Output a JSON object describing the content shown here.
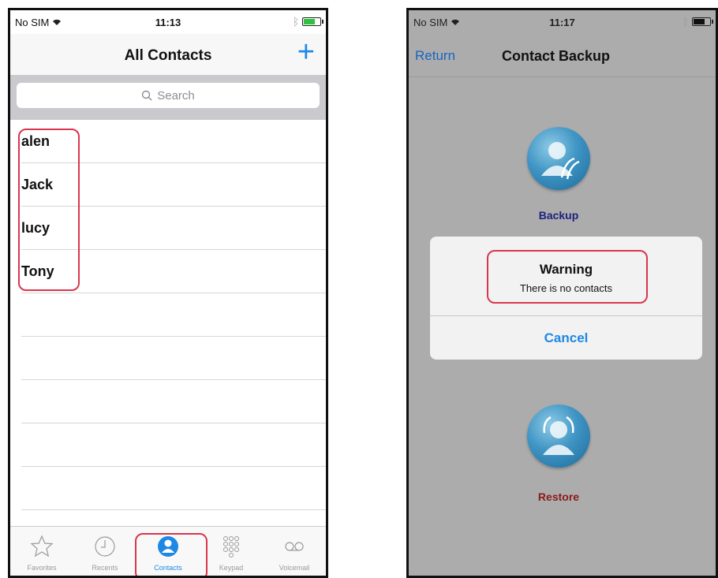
{
  "left_screen": {
    "status": {
      "carrier": "No SIM",
      "time": "11:13"
    },
    "nav": {
      "title": "All Contacts",
      "add_label": "+"
    },
    "search": {
      "placeholder": "Search"
    },
    "contacts": [
      "alen",
      "Jack",
      "lucy",
      "Tony"
    ],
    "tabs": [
      {
        "label": "Favorites",
        "icon": "star-icon"
      },
      {
        "label": "Recents",
        "icon": "clock-icon"
      },
      {
        "label": "Contacts",
        "icon": "person-icon",
        "active": true
      },
      {
        "label": "Keypad",
        "icon": "keypad-icon"
      },
      {
        "label": "Voicemail",
        "icon": "voicemail-icon"
      }
    ]
  },
  "right_screen": {
    "status": {
      "carrier": "No SIM",
      "time": "11:17"
    },
    "nav": {
      "back_label": "Return",
      "title": "Contact Backup"
    },
    "actions": {
      "backup_label": "Backup",
      "restore_label": "Restore"
    },
    "alert": {
      "title": "Warning",
      "message": "There is no contacts",
      "cancel_label": "Cancel"
    }
  },
  "colors": {
    "accent": "#1e88e5",
    "highlight": "#d9364d",
    "backup_text": "#1a237e",
    "restore_text": "#8b1a1a"
  }
}
